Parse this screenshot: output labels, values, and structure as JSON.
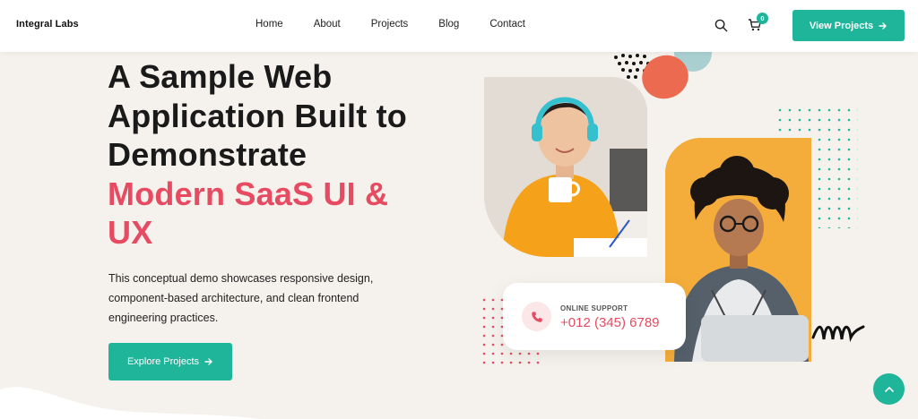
{
  "header": {
    "brand": "Integral Labs",
    "nav": [
      "Home",
      "About",
      "Projects",
      "Blog",
      "Contact"
    ],
    "cart_count": "0",
    "cta_label": "View Projects",
    "icons": {
      "search": "search-icon",
      "cart": "cart-icon",
      "arrow": "arrow-right-icon"
    }
  },
  "hero": {
    "headline_lines": [
      "A Sample Web",
      "Application Built to",
      "Demonstrate"
    ],
    "accent_lines": [
      "Modern SaaS UI &",
      "UX"
    ],
    "description_lines": [
      "This conceptual demo showcases responsive design,",
      "component-based architecture, and clean frontend",
      "engineering practices."
    ],
    "cta_label": "Explore Projects"
  },
  "support": {
    "label": "ONLINE SUPPORT",
    "phone": "+012 (345) 6789"
  },
  "colors": {
    "accent_teal": "#1fb59a",
    "accent_pink": "#e64b61",
    "background": "#f5f1ec",
    "coral": "#ec6a50",
    "photo_orange": "#f4ad3a"
  }
}
